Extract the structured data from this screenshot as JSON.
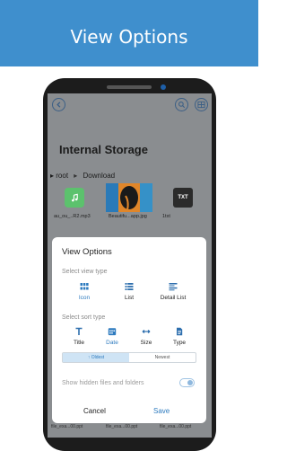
{
  "banner": {
    "title": "View Options"
  },
  "storage": {
    "title": "Internal Storage",
    "breadcrumb": [
      "root",
      "Download"
    ],
    "files": [
      {
        "name": "au_ou_..R2.mp3",
        "icon": "music-icon"
      },
      {
        "name": "Beautifu...app.jpg",
        "icon": "image-thumbnail"
      },
      {
        "name": "1txt",
        "icon": "txt-icon",
        "badge": "TXT"
      }
    ],
    "bottom_row": [
      "file_exa...00.ppt",
      "file_exa...00.ppt",
      "file_exa...00.ppt"
    ]
  },
  "dialog": {
    "title": "View Options",
    "view_type_label": "Select view type",
    "view_types": [
      {
        "label": "Icon",
        "icon": "grid-icon",
        "selected": true
      },
      {
        "label": "List",
        "icon": "list-icon",
        "selected": false
      },
      {
        "label": "Detail List",
        "icon": "detail-list-icon",
        "selected": false
      }
    ],
    "sort_type_label": "Select sort type",
    "sort_types": [
      {
        "label": "Title",
        "icon": "title-icon",
        "selected": false
      },
      {
        "label": "Date",
        "icon": "calendar-icon",
        "selected": true
      },
      {
        "label": "Size",
        "icon": "size-icon",
        "selected": false
      },
      {
        "label": "Type",
        "icon": "file-type-icon",
        "selected": false
      }
    ],
    "order": {
      "oldest": "↑ Oldest",
      "newest": "Newest",
      "selected": "oldest"
    },
    "hidden_files_label": "Show hidden files and folders",
    "hidden_files_on": false,
    "cancel_label": "Cancel",
    "save_label": "Save"
  },
  "colors": {
    "banner": "#3f8fcd",
    "accent": "#2e7bbf",
    "dim": "#8a8d90"
  }
}
